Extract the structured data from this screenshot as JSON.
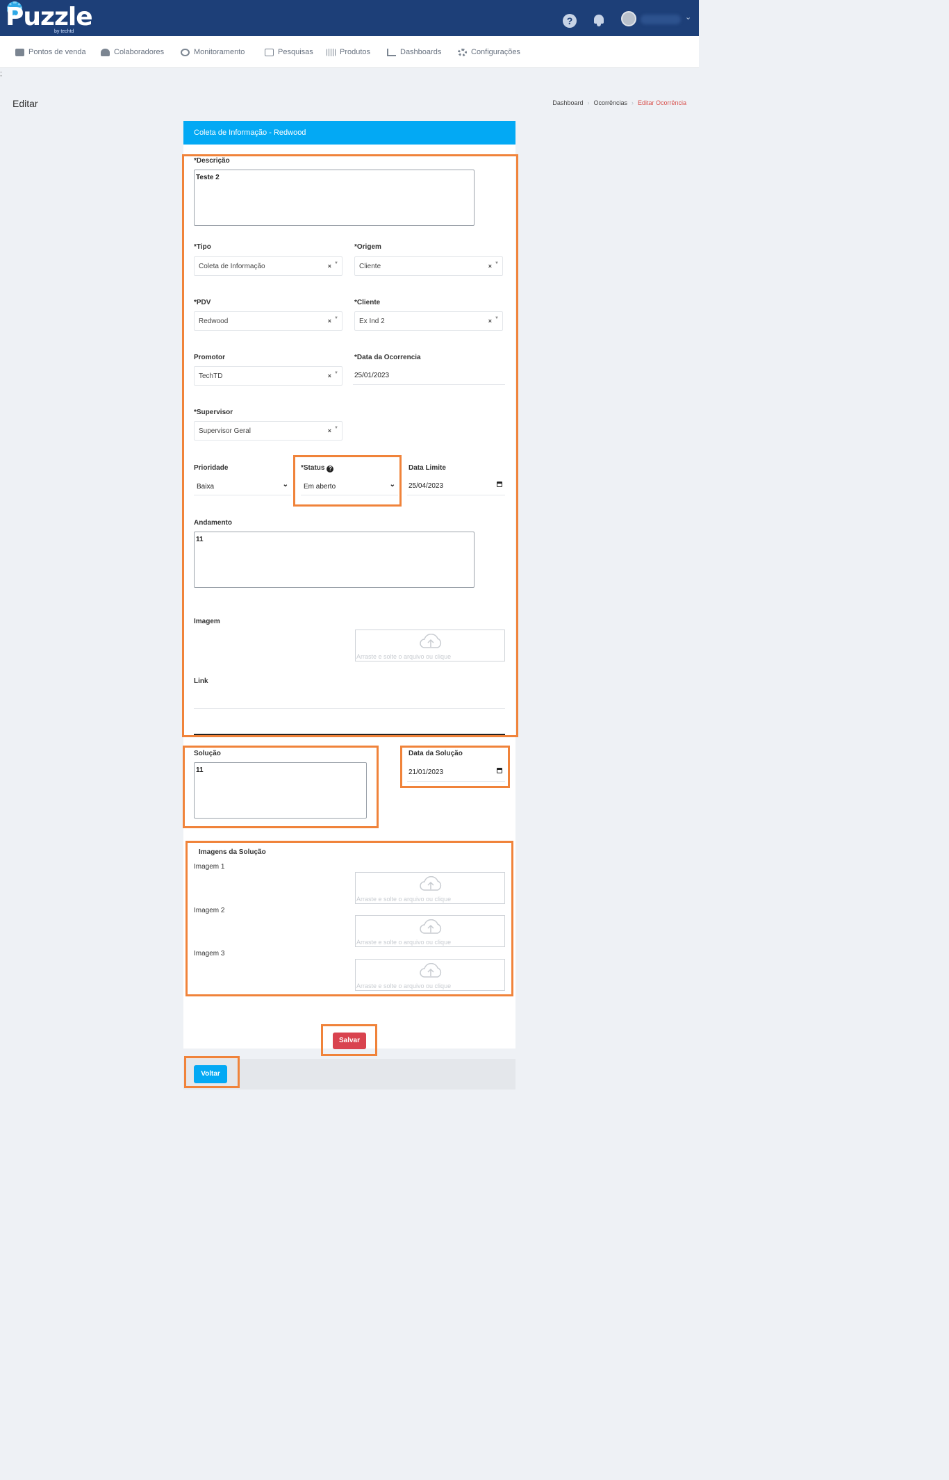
{
  "header": {
    "logo_text": "Puzzle",
    "logo_sub": "by techtd",
    "help_icon": "?",
    "user_name": ""
  },
  "nav": [
    {
      "label": "Pontos de venda",
      "icon": "store-icon"
    },
    {
      "label": "Colaboradores",
      "icon": "users-icon"
    },
    {
      "label": "Monitoramento",
      "icon": "globe-icon"
    },
    {
      "label": "Pesquisas",
      "icon": "calendar-icon"
    },
    {
      "label": "Produtos",
      "icon": "barcode-icon"
    },
    {
      "label": "Dashboards",
      "icon": "chart-icon"
    },
    {
      "label": "Configurações",
      "icon": "gears-icon"
    }
  ],
  "stray_char": ";",
  "page": {
    "title": "Editar",
    "breadcrumb": [
      "Dashboard",
      "Ocorrências",
      "Editar Ocorrência"
    ]
  },
  "form": {
    "header": "Coleta de Informação - Redwood",
    "descricao": {
      "label": "*Descrição",
      "value": "Teste 2"
    },
    "tipo": {
      "label": "*Tipo",
      "value": "Coleta de Informação"
    },
    "origem": {
      "label": "*Origem",
      "value": "Cliente"
    },
    "pdv": {
      "label": "*PDV",
      "value": "Redwood"
    },
    "cliente": {
      "label": "*Cliente",
      "value": "Ex Ind 2"
    },
    "promotor": {
      "label": "Promotor",
      "value": "TechTD"
    },
    "data_ocorrencia": {
      "label": "*Data da Ocorrencia",
      "value": "25/01/2023"
    },
    "supervisor": {
      "label": "*Supervisor",
      "value": "Supervisor Geral"
    },
    "prioridade": {
      "label": "Prioridade",
      "value": "Baixa"
    },
    "status": {
      "label": "*Status",
      "value": "Em aberto"
    },
    "data_limite": {
      "label": "Data Limite",
      "value": "25/04/2023"
    },
    "andamento": {
      "label": "Andamento",
      "value": "11"
    },
    "imagem": {
      "label": "Imagem"
    },
    "link": {
      "label": "Link",
      "value": ""
    },
    "solucao": {
      "label": "Solução",
      "value": "11"
    },
    "data_solucao": {
      "label": "Data da Solução",
      "value": "21/01/2023"
    },
    "imagens_solucao": {
      "title": "Imagens da Solução",
      "items": [
        "Imagem 1",
        "Imagem 2",
        "Imagem 3"
      ]
    },
    "dropzone_text": "Arraste e solte o arquivo ou clique",
    "clear_symbol": "×",
    "save_label": "Salvar",
    "back_label": "Voltar"
  },
  "colors": {
    "header_bg": "#1d3f78",
    "card_header_bg": "#03a9f4",
    "save_button": "#d9434f",
    "back_button": "#03a9f4",
    "highlight": "#f0833a",
    "breadcrumb_active": "#d9534f"
  }
}
